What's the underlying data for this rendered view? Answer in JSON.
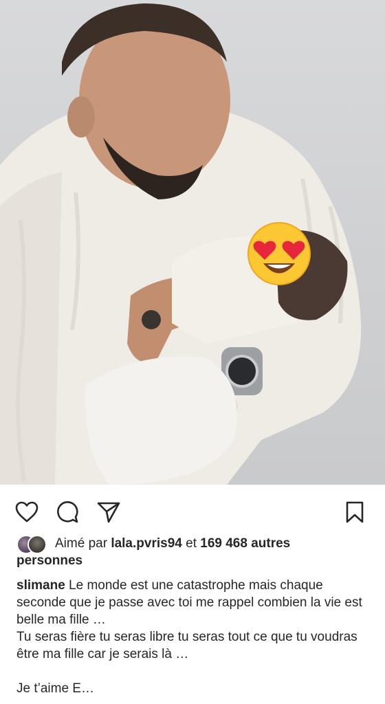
{
  "post": {
    "image_alt": "photo",
    "emoji_overlay": "😍"
  },
  "actions": {
    "like_icon": "heart-icon",
    "comment_icon": "comment-icon",
    "share_icon": "send-icon",
    "save_icon": "bookmark-icon"
  },
  "likes": {
    "prefix": "Aimé par",
    "liker": "lala.pvris94",
    "connector": "et",
    "count_text": "169 468 autres",
    "count_suffix": "personnes"
  },
  "caption": {
    "username": "slimane",
    "line1": "Le monde est une catastrophe mais chaque seconde que je passe avec toi me rappel combien la vie est belle ma fille …",
    "line2": "Tu seras fière tu seras libre tu seras tout ce que tu voudras être ma fille car je serais là …",
    "line3": "Je t’aime E…"
  },
  "colors": {
    "text": "#262626",
    "background": "#ffffff"
  }
}
